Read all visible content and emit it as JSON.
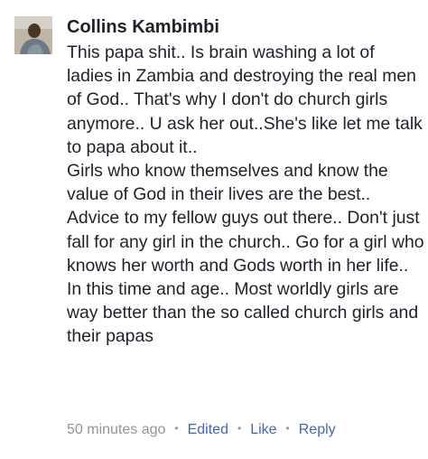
{
  "comment": {
    "author": "Collins Kambimbi",
    "paragraphs": [
      "This papa shit.. Is brain washing a lot of ladies in Zambia and destroying the real men of God.. That's why I don't do church girls anymore.. U ask her out..She's like let me talk to papa about it..",
      "Girls who know themselves and know the value of God in their lives are the best.. Advice to my fellow guys out there.. Don't just fall for any girl in the church.. Go for a girl who knows her worth and Gods worth in her life.. In this time and age.. Most worldly girls are way better than the so called church girls and their papas"
    ],
    "timestamp": "50 minutes ago",
    "separator": "•",
    "edited_label": "Edited",
    "like_label": "Like",
    "reply_label": "Reply"
  },
  "colors": {
    "text": "#1d2129",
    "meta_gray": "#90949c",
    "link_blue": "#4267b2"
  },
  "icons": {
    "avatar": "user-profile-photo"
  }
}
